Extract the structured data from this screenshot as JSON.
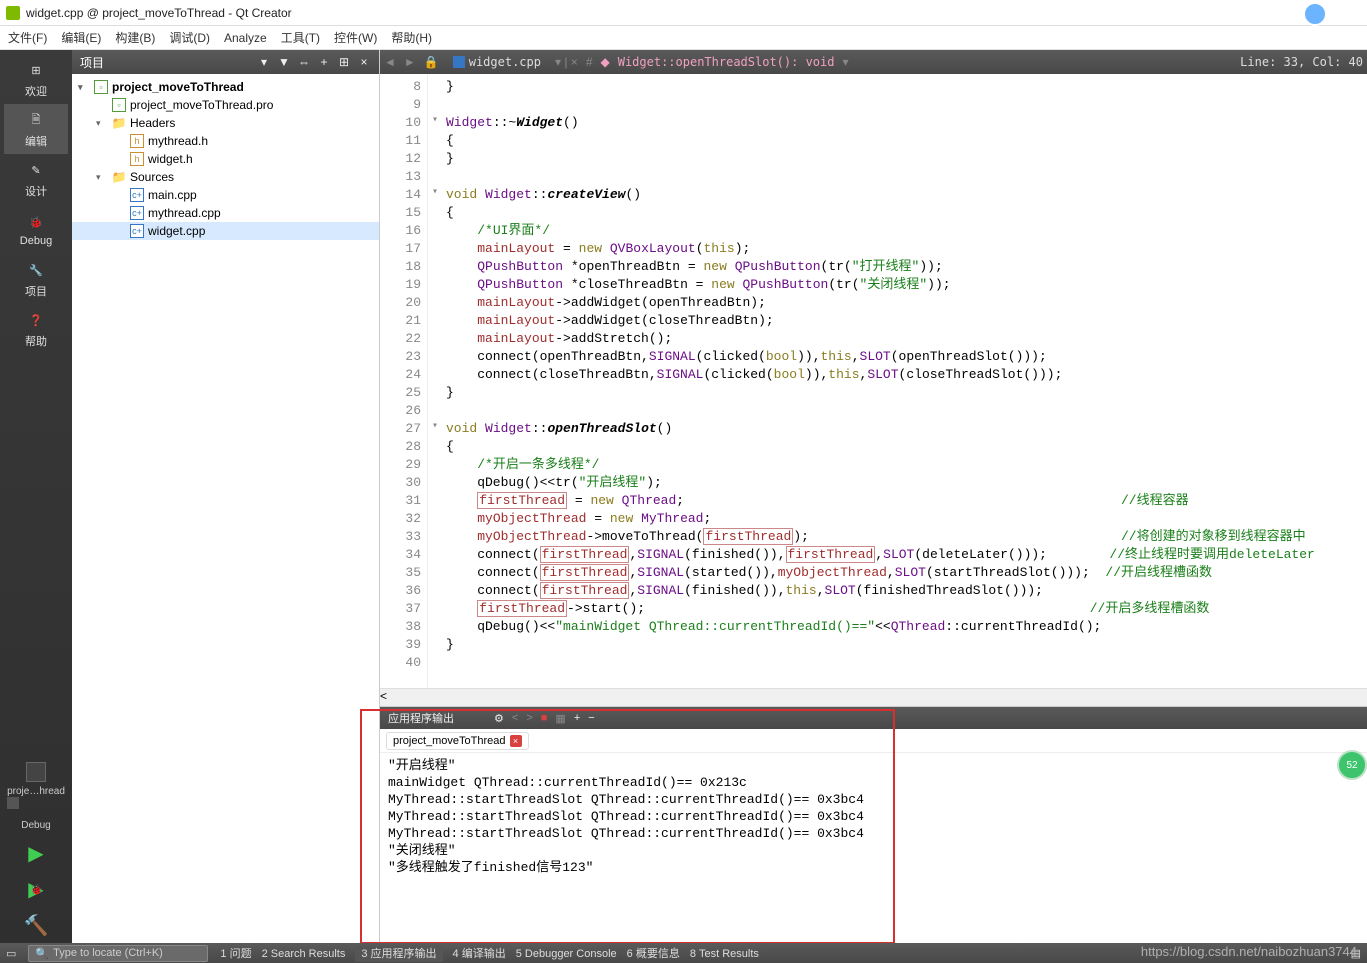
{
  "titlebar": {
    "title": "widget.cpp @ project_moveToThread - Qt Creator"
  },
  "menu": [
    "文件(F)",
    "编辑(E)",
    "构建(B)",
    "调试(D)",
    "Analyze",
    "工具(T)",
    "控件(W)",
    "帮助(H)"
  ],
  "leftTools": [
    {
      "label": "欢迎",
      "icon": "grid"
    },
    {
      "label": "编辑",
      "icon": "edit",
      "active": true
    },
    {
      "label": "设计",
      "icon": "pencil"
    },
    {
      "label": "Debug",
      "icon": "bug"
    },
    {
      "label": "项目",
      "icon": "wrench"
    },
    {
      "label": "帮助",
      "icon": "help"
    }
  ],
  "config": {
    "project": "proje…hread",
    "mode": "Debug"
  },
  "sidebar": {
    "title": "项目",
    "tree": [
      {
        "indent": 0,
        "chev": "▾",
        "icon": "pro",
        "label": "project_moveToThread",
        "bold": true
      },
      {
        "indent": 1,
        "chev": "",
        "icon": "pro",
        "label": "project_moveToThread.pro"
      },
      {
        "indent": 1,
        "chev": "▾",
        "icon": "folder",
        "label": "Headers"
      },
      {
        "indent": 2,
        "chev": "",
        "icon": "h",
        "label": "mythread.h"
      },
      {
        "indent": 2,
        "chev": "",
        "icon": "h",
        "label": "widget.h"
      },
      {
        "indent": 1,
        "chev": "▾",
        "icon": "folder",
        "label": "Sources"
      },
      {
        "indent": 2,
        "chev": "",
        "icon": "cpp",
        "label": "main.cpp"
      },
      {
        "indent": 2,
        "chev": "",
        "icon": "cpp",
        "label": "mythread.cpp"
      },
      {
        "indent": 2,
        "chev": "",
        "icon": "cpp",
        "label": "widget.cpp",
        "selected": true
      }
    ]
  },
  "editorToolbar": {
    "filename": "widget.cpp",
    "crumb": "Widget::openThreadSlot(): void",
    "lineinfo": "Line: 33, Col: 40"
  },
  "code": {
    "start": 8,
    "lines": [
      {
        "n": 8,
        "raw": "}"
      },
      {
        "n": 9,
        "raw": ""
      },
      {
        "n": 10,
        "fold": "▾",
        "seg": [
          {
            "t": "type",
            "v": "Widget"
          },
          {
            "t": "op",
            "v": "::~"
          },
          {
            "t": "funcdefb",
            "v": "Widget"
          },
          {
            "t": "op",
            "v": "()"
          }
        ]
      },
      {
        "n": 11,
        "raw": "{"
      },
      {
        "n": 12,
        "raw": "}"
      },
      {
        "n": 13,
        "raw": ""
      },
      {
        "n": 14,
        "fold": "▾",
        "seg": [
          {
            "t": "kw",
            "v": "void"
          },
          {
            "t": "op",
            "v": " "
          },
          {
            "t": "type",
            "v": "Widget"
          },
          {
            "t": "op",
            "v": "::"
          },
          {
            "t": "funcdefb",
            "v": "createView"
          },
          {
            "t": "op",
            "v": "()"
          }
        ]
      },
      {
        "n": 15,
        "raw": "{"
      },
      {
        "n": 16,
        "seg": [
          {
            "t": "op",
            "v": "    "
          },
          {
            "t": "cmt",
            "v": "/*UI界面*/"
          }
        ]
      },
      {
        "n": 17,
        "seg": [
          {
            "t": "op",
            "v": "    "
          },
          {
            "t": "ident",
            "v": "mainLayout"
          },
          {
            "t": "op",
            "v": " = "
          },
          {
            "t": "kw",
            "v": "new"
          },
          {
            "t": "op",
            "v": " "
          },
          {
            "t": "type",
            "v": "QVBoxLayout"
          },
          {
            "t": "op",
            "v": "("
          },
          {
            "t": "kw",
            "v": "this"
          },
          {
            "t": "op",
            "v": ");"
          }
        ]
      },
      {
        "n": 18,
        "seg": [
          {
            "t": "op",
            "v": "    "
          },
          {
            "t": "type",
            "v": "QPushButton"
          },
          {
            "t": "op",
            "v": " *openThreadBtn = "
          },
          {
            "t": "kw",
            "v": "new"
          },
          {
            "t": "op",
            "v": " "
          },
          {
            "t": "type",
            "v": "QPushButton"
          },
          {
            "t": "op",
            "v": "(tr("
          },
          {
            "t": "str",
            "v": "\"打开线程\""
          },
          {
            "t": "op",
            "v": "));"
          }
        ]
      },
      {
        "n": 19,
        "seg": [
          {
            "t": "op",
            "v": "    "
          },
          {
            "t": "type",
            "v": "QPushButton"
          },
          {
            "t": "op",
            "v": " *closeThreadBtn = "
          },
          {
            "t": "kw",
            "v": "new"
          },
          {
            "t": "op",
            "v": " "
          },
          {
            "t": "type",
            "v": "QPushButton"
          },
          {
            "t": "op",
            "v": "(tr("
          },
          {
            "t": "str",
            "v": "\"关闭线程\""
          },
          {
            "t": "op",
            "v": "));"
          }
        ]
      },
      {
        "n": 20,
        "seg": [
          {
            "t": "op",
            "v": "    "
          },
          {
            "t": "ident",
            "v": "mainLayout"
          },
          {
            "t": "op",
            "v": "->"
          },
          {
            "t": "func",
            "v": "addWidget"
          },
          {
            "t": "op",
            "v": "(openThreadBtn);"
          }
        ]
      },
      {
        "n": 21,
        "seg": [
          {
            "t": "op",
            "v": "    "
          },
          {
            "t": "ident",
            "v": "mainLayout"
          },
          {
            "t": "op",
            "v": "->"
          },
          {
            "t": "func",
            "v": "addWidget"
          },
          {
            "t": "op",
            "v": "(closeThreadBtn);"
          }
        ]
      },
      {
        "n": 22,
        "seg": [
          {
            "t": "op",
            "v": "    "
          },
          {
            "t": "ident",
            "v": "mainLayout"
          },
          {
            "t": "op",
            "v": "->"
          },
          {
            "t": "func",
            "v": "addStretch"
          },
          {
            "t": "op",
            "v": "();"
          }
        ]
      },
      {
        "n": 23,
        "seg": [
          {
            "t": "op",
            "v": "    connect(openThreadBtn,"
          },
          {
            "t": "type",
            "v": "SIGNAL"
          },
          {
            "t": "op",
            "v": "(clicked("
          },
          {
            "t": "kw",
            "v": "bool"
          },
          {
            "t": "op",
            "v": ")),"
          },
          {
            "t": "kw",
            "v": "this"
          },
          {
            "t": "op",
            "v": ","
          },
          {
            "t": "type",
            "v": "SLOT"
          },
          {
            "t": "op",
            "v": "(openThreadSlot()));"
          }
        ]
      },
      {
        "n": 24,
        "seg": [
          {
            "t": "op",
            "v": "    connect(closeThreadBtn,"
          },
          {
            "t": "type",
            "v": "SIGNAL"
          },
          {
            "t": "op",
            "v": "(clicked("
          },
          {
            "t": "kw",
            "v": "bool"
          },
          {
            "t": "op",
            "v": ")),"
          },
          {
            "t": "kw",
            "v": "this"
          },
          {
            "t": "op",
            "v": ","
          },
          {
            "t": "type",
            "v": "SLOT"
          },
          {
            "t": "op",
            "v": "(closeThreadSlot()));"
          }
        ]
      },
      {
        "n": 25,
        "raw": "}"
      },
      {
        "n": 26,
        "raw": ""
      },
      {
        "n": 27,
        "fold": "▾",
        "seg": [
          {
            "t": "kw",
            "v": "void"
          },
          {
            "t": "op",
            "v": " "
          },
          {
            "t": "type",
            "v": "Widget"
          },
          {
            "t": "op",
            "v": "::"
          },
          {
            "t": "funcdefb",
            "v": "openThreadSlot"
          },
          {
            "t": "op",
            "v": "()"
          }
        ]
      },
      {
        "n": 28,
        "raw": "{"
      },
      {
        "n": 29,
        "seg": [
          {
            "t": "op",
            "v": "    "
          },
          {
            "t": "cmt",
            "v": "/*开启一条多线程*/"
          }
        ]
      },
      {
        "n": 30,
        "seg": [
          {
            "t": "op",
            "v": "    qDebug()<<tr("
          },
          {
            "t": "str",
            "v": "\"开启线程\""
          },
          {
            "t": "op",
            "v": ");"
          }
        ]
      },
      {
        "n": 31,
        "seg": [
          {
            "t": "op",
            "v": "    "
          },
          {
            "t": "identbox",
            "v": "firstThread"
          },
          {
            "t": "op",
            "v": " = "
          },
          {
            "t": "kw",
            "v": "new"
          },
          {
            "t": "op",
            "v": " "
          },
          {
            "t": "type",
            "v": "QThread"
          },
          {
            "t": "op",
            "v": ";                                                        "
          },
          {
            "t": "cmt",
            "v": "//线程容器"
          }
        ]
      },
      {
        "n": 32,
        "seg": [
          {
            "t": "op",
            "v": "    "
          },
          {
            "t": "ident",
            "v": "myObjectThread"
          },
          {
            "t": "op",
            "v": " = "
          },
          {
            "t": "kw",
            "v": "new"
          },
          {
            "t": "op",
            "v": " "
          },
          {
            "t": "type",
            "v": "MyThread"
          },
          {
            "t": "op",
            "v": ";"
          }
        ]
      },
      {
        "n": 33,
        "seg": [
          {
            "t": "op",
            "v": "    "
          },
          {
            "t": "ident",
            "v": "myObjectThread"
          },
          {
            "t": "op",
            "v": "->"
          },
          {
            "t": "func",
            "v": "moveToThread"
          },
          {
            "t": "op",
            "v": "("
          },
          {
            "t": "identbox",
            "v": "firstThread"
          },
          {
            "t": "op",
            "v": ");                                        "
          },
          {
            "t": "cmt",
            "v": "//将创建的对象移到线程容器中"
          }
        ]
      },
      {
        "n": 34,
        "seg": [
          {
            "t": "op",
            "v": "    connect("
          },
          {
            "t": "identbox",
            "v": "firstThread"
          },
          {
            "t": "op",
            "v": ","
          },
          {
            "t": "type",
            "v": "SIGNAL"
          },
          {
            "t": "op",
            "v": "(finished()),"
          },
          {
            "t": "identbox",
            "v": "firstThread"
          },
          {
            "t": "op",
            "v": ","
          },
          {
            "t": "type",
            "v": "SLOT"
          },
          {
            "t": "op",
            "v": "(deleteLater()));        "
          },
          {
            "t": "cmt",
            "v": "//终止线程时要调用deleteLater"
          }
        ]
      },
      {
        "n": 35,
        "seg": [
          {
            "t": "op",
            "v": "    connect("
          },
          {
            "t": "identbox",
            "v": "firstThread"
          },
          {
            "t": "op",
            "v": ","
          },
          {
            "t": "type",
            "v": "SIGNAL"
          },
          {
            "t": "op",
            "v": "(started()),"
          },
          {
            "t": "ident",
            "v": "myObjectThread"
          },
          {
            "t": "op",
            "v": ","
          },
          {
            "t": "type",
            "v": "SLOT"
          },
          {
            "t": "op",
            "v": "(startThreadSlot()));  "
          },
          {
            "t": "cmt",
            "v": "//开启线程槽函数"
          }
        ]
      },
      {
        "n": 36,
        "seg": [
          {
            "t": "op",
            "v": "    connect("
          },
          {
            "t": "identbox",
            "v": "firstThread"
          },
          {
            "t": "op",
            "v": ","
          },
          {
            "t": "type",
            "v": "SIGNAL"
          },
          {
            "t": "op",
            "v": "(finished()),"
          },
          {
            "t": "kw",
            "v": "this"
          },
          {
            "t": "op",
            "v": ","
          },
          {
            "t": "type",
            "v": "SLOT"
          },
          {
            "t": "op",
            "v": "(finishedThreadSlot()));"
          }
        ]
      },
      {
        "n": 37,
        "seg": [
          {
            "t": "op",
            "v": "    "
          },
          {
            "t": "identbox",
            "v": "firstThread"
          },
          {
            "t": "op",
            "v": "->"
          },
          {
            "t": "func",
            "v": "start"
          },
          {
            "t": "op",
            "v": "();                                                         "
          },
          {
            "t": "cmt",
            "v": "//开启多线程槽函数"
          }
        ]
      },
      {
        "n": 38,
        "seg": [
          {
            "t": "op",
            "v": "    qDebug()<<"
          },
          {
            "t": "str",
            "v": "\"mainWidget QThread::currentThreadId()==\""
          },
          {
            "t": "op",
            "v": "<<"
          },
          {
            "t": "type",
            "v": "QThread"
          },
          {
            "t": "op",
            "v": "::"
          },
          {
            "t": "func",
            "v": "currentThreadId"
          },
          {
            "t": "op",
            "v": "();"
          }
        ]
      },
      {
        "n": 39,
        "raw": "}"
      },
      {
        "n": 40,
        "raw": ""
      }
    ]
  },
  "output": {
    "title": "应用程序输出",
    "tab": "project_moveToThread",
    "lines": [
      "\"开启线程\"",
      "mainWidget QThread::currentThreadId()== 0x213c",
      "MyThread::startThreadSlot QThread::currentThreadId()== 0x3bc4",
      "MyThread::startThreadSlot QThread::currentThreadId()== 0x3bc4",
      "MyThread::startThreadSlot QThread::currentThreadId()== 0x3bc4",
      "\"关闭线程\"",
      "\"多线程触发了finished信号123\""
    ]
  },
  "statusbar": {
    "locator": "Type to locate (Ctrl+K)",
    "panels": [
      "1 问题",
      "2 Search Results",
      "3 应用程序输出",
      "4 编译输出",
      "5 Debugger Console",
      "6 概要信息",
      "8 Test Results"
    ],
    "activePanel": 2
  },
  "watermark": "https://blog.csdn.net/naibozhuan3744"
}
